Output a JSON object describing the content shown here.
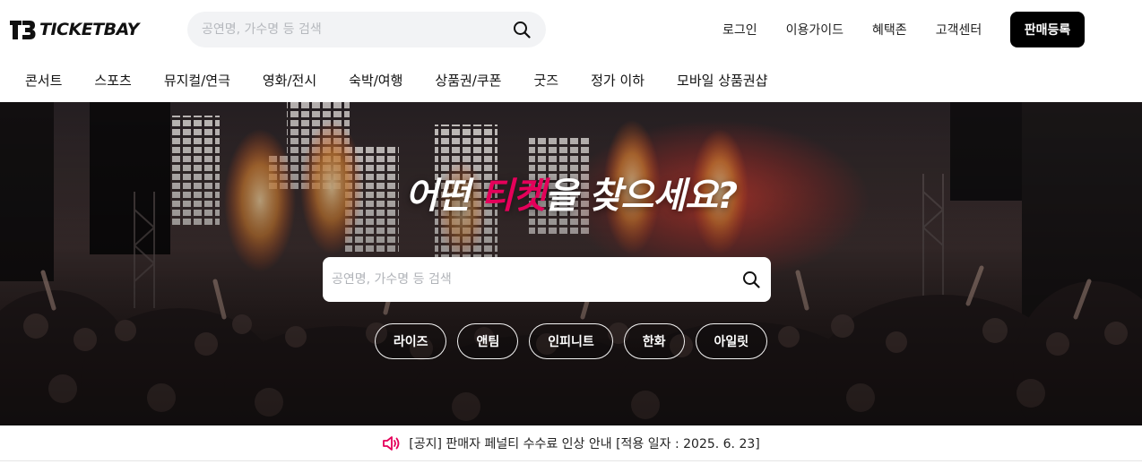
{
  "brand": {
    "name": "TICKETBAY",
    "accent_color": "#e5005a"
  },
  "header": {
    "search": {
      "placeholder": "공연명, 가수명 등 검색",
      "icon": "search-icon"
    },
    "links": [
      "로그인",
      "이용가이드",
      "혜택존",
      "고객센터"
    ],
    "sell_button": "판매등록"
  },
  "categories": [
    "콘서트",
    "스포츠",
    "뮤지컬/연극",
    "영화/전시",
    "숙박/여행",
    "상품권/쿠폰",
    "굿즈",
    "정가 이하",
    "모바일 상품권샵"
  ],
  "hero": {
    "title_before": "어떤 ",
    "title_accent": "티켓",
    "title_after": "을 찾으세요?",
    "search": {
      "placeholder": "공연명, 가수명 등 검색",
      "icon": "search-icon"
    },
    "keywords": [
      "라이즈",
      "앤팀",
      "인피니트",
      "한화",
      "아일릿"
    ]
  },
  "notice": {
    "icon": "speaker-icon",
    "text": "[공지] 판매자 페널티 수수료 인상 안내 [적용 일자 : 2025. 6. 23]"
  }
}
